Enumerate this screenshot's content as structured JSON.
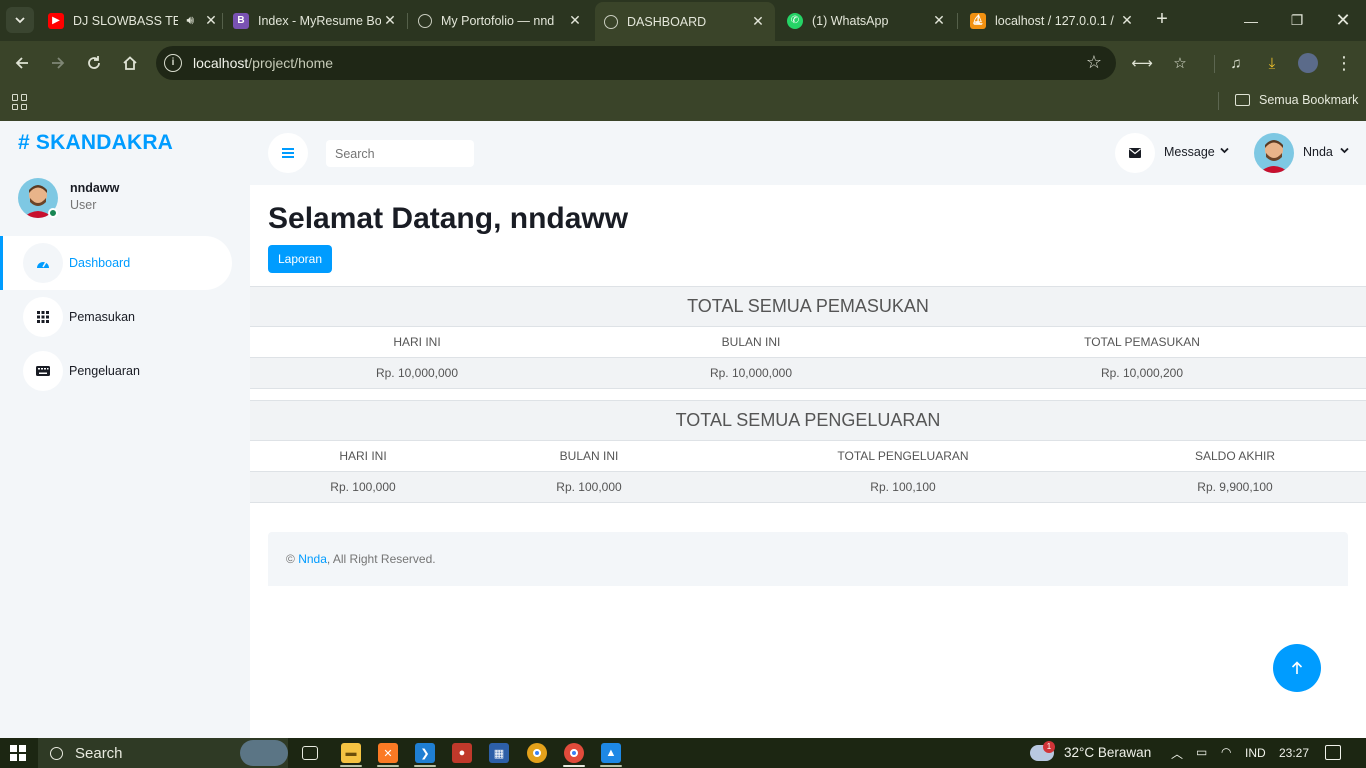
{
  "browser": {
    "tabs": [
      {
        "title": "DJ SLOWBASS TE",
        "favicon": "youtube-icon",
        "color": "#ff0000"
      },
      {
        "title": "Index - MyResume Bo",
        "favicon": "bootstrap-icon",
        "color": "#7952b3"
      },
      {
        "title": "My Portofolio — nnd",
        "favicon": "globe-icon",
        "color": "#9aa0a6"
      },
      {
        "title": "DASHBOARD",
        "favicon": "globe-icon",
        "color": "#9aa0a6"
      },
      {
        "title": "(1) WhatsApp",
        "favicon": "whatsapp-icon",
        "color": "#25d366"
      },
      {
        "title": "localhost / 127.0.0.1 /",
        "favicon": "phpmyadmin-icon",
        "color": "#f29111"
      }
    ],
    "active_tab_index": 3,
    "url_host": "localhost",
    "url_path": "/project/home",
    "bookmarks_folder": "Semua Bookmark"
  },
  "sidebar": {
    "brand": "# SKANDAKRA",
    "user": {
      "name": "nndaww",
      "role": "User"
    },
    "items": [
      {
        "label": "Dashboard",
        "icon": "tachometer-icon",
        "active": true
      },
      {
        "label": "Pemasukan",
        "icon": "grid-icon",
        "active": false
      },
      {
        "label": "Pengeluaran",
        "icon": "keyboard-icon",
        "active": false
      }
    ]
  },
  "topnav": {
    "search_placeholder": "Search",
    "message_label": "Message",
    "user_name": "Nnda"
  },
  "main": {
    "welcome": "Selamat Datang, nndaww",
    "laporan_button": "Laporan",
    "income": {
      "title": "TOTAL SEMUA PEMASUKAN",
      "headers": [
        "HARI INI",
        "BULAN INI",
        "TOTAL PEMASUKAN"
      ],
      "values": [
        "Rp. 10,000,000",
        "Rp. 10,000,000",
        "Rp. 10,000,200"
      ]
    },
    "expense": {
      "title": "TOTAL SEMUA PENGELUARAN",
      "headers": [
        "HARI INI",
        "BULAN INI",
        "TOTAL PENGELUARAN",
        "SALDO AKHIR"
      ],
      "values": [
        "Rp. 100,000",
        "Rp. 100,000",
        "Rp. 100,100",
        "Rp. 9,900,100"
      ]
    },
    "footer": {
      "copyright": "©",
      "link": "Nnda",
      "rest": ", All Right Reserved."
    }
  },
  "taskbar": {
    "search_label": "Search",
    "weather_badge": "1",
    "weather": "32°C  Berawan",
    "language": "IND",
    "time": "23:27"
  },
  "colors": {
    "accent": "#009cff",
    "sidebar_bg": "#f3f6f9",
    "browser_frame": "#3a4429"
  }
}
